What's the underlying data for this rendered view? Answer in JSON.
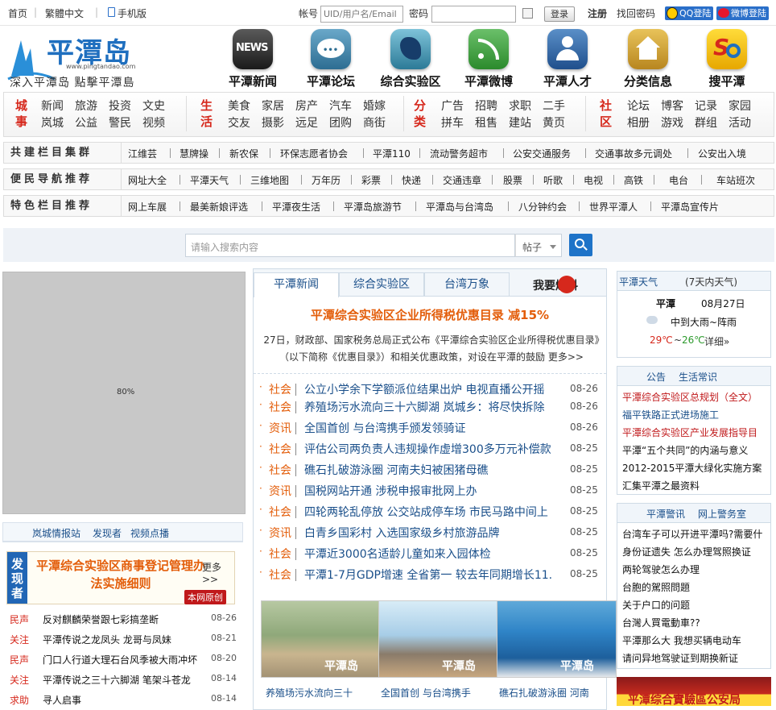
{
  "topbar": {
    "home": "首页",
    "trad": "繁體中文",
    "mobile": "手机版",
    "account_label": "帐号",
    "account_placeholder": "UID/用户名/Email",
    "password_label": "密码",
    "login": "登录",
    "register": "注册",
    "forgot": "找回密码",
    "qq": "QQ登陆",
    "weibo": "微博登陆"
  },
  "logo": {
    "name": "平潭岛",
    "domain": "www.pingtandao.com",
    "slogan": "深入平潭岛 點擊平潭島"
  },
  "nav": [
    {
      "label": "平潭新闻",
      "badge": "NEWS"
    },
    {
      "label": "平潭论坛"
    },
    {
      "label": "综合实验区"
    },
    {
      "label": "平潭微博"
    },
    {
      "label": "平潭人才"
    },
    {
      "label": "分类信息"
    },
    {
      "label": "搜平潭"
    }
  ],
  "categories": [
    {
      "head": "城事",
      "items": [
        "新闻",
        "旅游",
        "投资",
        "文史",
        "岚城",
        "公益",
        "警民",
        "视频"
      ]
    },
    {
      "head": "生活",
      "items": [
        "美食",
        "家居",
        "房产",
        "汽车",
        "婚嫁",
        "交友",
        "摄影",
        "远足",
        "团购",
        "商街"
      ]
    },
    {
      "head": "分类",
      "items": [
        "广告",
        "招聘",
        "求职",
        "二手",
        "拼车",
        "租售",
        "建站",
        "黄页"
      ]
    },
    {
      "head": "社区",
      "items": [
        "论坛",
        "博客",
        "记录",
        "家园",
        "相册",
        "游戏",
        "群组",
        "活动"
      ]
    }
  ],
  "rows": [
    {
      "head": "共建栏目集群",
      "items": [
        "江维芸",
        "慧牌操",
        "新农保",
        "环保志愿者协会",
        "平潭110",
        "流动警务超市",
        "公安交通服务",
        "交通事故多元调处",
        "公安出入境"
      ]
    },
    {
      "head": "便民导航推荐",
      "items": [
        "网址大全",
        "平潭天气",
        "三维地图",
        "万年历",
        "彩票",
        "快递",
        "交通违章",
        "股票",
        "听歌",
        "电视",
        "高铁",
        "电台",
        "车站班次"
      ]
    },
    {
      "head": "特色栏目推荐",
      "items": [
        "网上车展",
        "最美新娘评选",
        "平潭夜生活",
        "平潭岛旅游节",
        "平潭岛与台湾岛",
        "八分钟约会",
        "世界平潭人",
        "平潭岛宣传片"
      ]
    }
  ],
  "search": {
    "placeholder": "请输入搜索内容",
    "scope": "帖子"
  },
  "left": {
    "placeholder_label": "80%",
    "tabs": [
      "岚城情报站",
      "发现者",
      "视频点播"
    ],
    "banner": {
      "side": "发现者",
      "title": "平潭综合实验区商事登记管理办法实施细则",
      "more": "更多>>",
      "tag": "本网原创"
    },
    "news": [
      {
        "cat": "民声",
        "title": "反对麒麟荣誉跟七彩搞垄断",
        "date": "08-26"
      },
      {
        "cat": "关注",
        "title": "平潭传说之龙凤头 龙哥与凤妹",
        "date": "08-21"
      },
      {
        "cat": "民声",
        "title": "门口人行道大理石台风季被大雨冲坏",
        "date": "08-20"
      },
      {
        "cat": "关注",
        "title": "平潭传说之三十六脚湖 笔架斗苍龙",
        "date": "08-14"
      },
      {
        "cat": "求助",
        "title": "寻人启事",
        "date": "08-14"
      }
    ]
  },
  "center": {
    "tabs": [
      "平潭新闻",
      "综合实验区",
      "台湾万象"
    ],
    "baoliao": "我要爆料",
    "headline": "平潭综合实验区企业所得税优惠目录 减15%",
    "summary": "27日，财政部、国家税务总局正式公布《平潭综合实验区企业所得税优惠目录》（以下简称《优惠目录》）和相关优惠政策，对设在平潭的鼓励 更多>>",
    "news": [
      {
        "cat": "社会",
        "title": "公立小学余下学额派位结果出炉 电视直播公开摇",
        "date": "08-26"
      },
      {
        "cat": "社会",
        "title": "养殖场污水流向三十六脚湖 岚城乡：将尽快拆除",
        "date": "08-26"
      },
      {
        "cat": "资讯",
        "title": "全国首创 与台湾携手颁发领骑证",
        "date": "08-26"
      },
      {
        "cat": "社会",
        "title": "评估公司两负责人违规操作虚增300多万元补偿款",
        "date": "08-25"
      },
      {
        "cat": "社会",
        "title": "礁石扎破游泳圈 河南夫妇被困猪母礁",
        "date": "08-25"
      },
      {
        "cat": "资讯",
        "title": "国税网站开通 涉税申报审批网上办",
        "date": "08-25"
      },
      {
        "cat": "社会",
        "title": "四轮两轮乱停放 公交站成停车场 市民马路中间上",
        "date": "08-25"
      },
      {
        "cat": "资讯",
        "title": "白青乡国彩村 入选国家级乡村旅游品牌",
        "date": "08-25"
      },
      {
        "cat": "社会",
        "title": "平潭近3000名适龄儿童如来入园体检",
        "date": "08-25"
      },
      {
        "cat": "社会",
        "title": "平潭1-7月GDP增速 全省第一 较去年同期增长11.",
        "date": "08-25"
      }
    ],
    "pics": [
      {
        "caption": "养殖场污水流向三十",
        "mark": "平潭岛"
      },
      {
        "caption": "全国首创 与台湾携手",
        "mark": "平潭岛"
      },
      {
        "caption": "礁石扎破游泳圈 河南",
        "mark": "平潭岛"
      }
    ]
  },
  "right": {
    "weather": {
      "title": "平潭天气",
      "week": "(7天内天气)",
      "place": "平潭",
      "date": "08月27日",
      "desc": "中到大雨~阵雨",
      "high": "29℃",
      "tilde": "~",
      "low": "26℃",
      "detail": "详细»"
    },
    "notice": {
      "tabs": [
        "公告",
        "生活常识"
      ],
      "items": [
        "平潭综合实验区总规划（全文）",
        "福平铁路正式进场施工",
        "平潭综合实验区产业发展指导目",
        "平潭“五个共同”的内涵与意义",
        "2012-2015平潭大绿化实施方案",
        "汇集平潭之最资料"
      ]
    },
    "police": {
      "tabs": [
        "平潭警讯",
        "网上警务室"
      ],
      "items": [
        "台湾车子可以开进平潭吗?需要什",
        "身份证遗失 怎么办理驾照换证",
        "两轮驾驶怎么办理",
        "台胞的駕照問題",
        "关于户口的问题",
        "台灣人買電動車??",
        "平潭那么大 我想买辆电动车",
        "请问异地驾驶证到期换新证"
      ]
    },
    "ad": "平潭综合實驗區公安局"
  },
  "colors": {
    "accent": "#1a4f8a",
    "orange": "#e35d0a",
    "red": "#d6281c"
  }
}
